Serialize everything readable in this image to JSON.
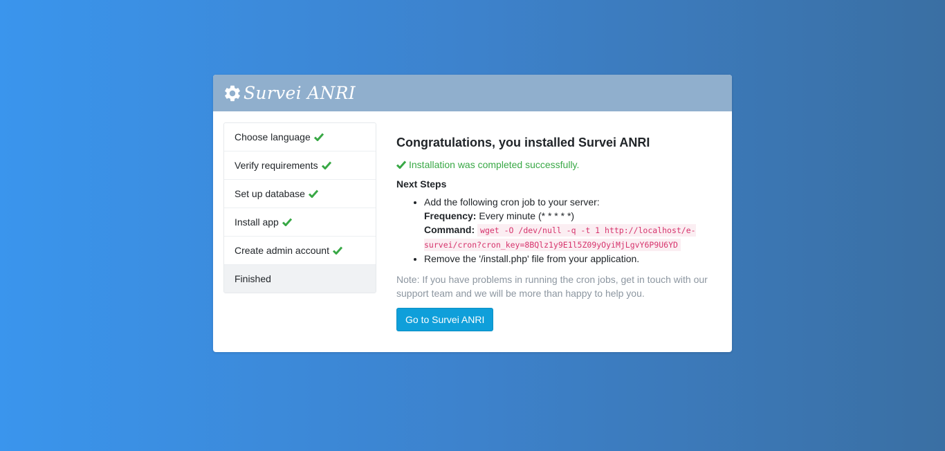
{
  "app": {
    "title": "Survei ANRI"
  },
  "steps": [
    {
      "label": "Choose language",
      "done": true
    },
    {
      "label": "Verify requirements",
      "done": true
    },
    {
      "label": "Set up database",
      "done": true
    },
    {
      "label": "Install app",
      "done": true
    },
    {
      "label": "Create admin account",
      "done": true
    },
    {
      "label": "Finished",
      "done": false,
      "active": true
    }
  ],
  "main": {
    "title": "Congratulations, you installed Survei ANRI",
    "success": "Installation was completed successfully.",
    "next_steps": "Next Steps",
    "cron_intro": "Add the following cron job to your server:",
    "frequency_label": "Frequency:",
    "frequency_value": "Every minute (* * * * *)",
    "command_label": "Command:",
    "command_value": "wget -O /dev/null -q -t 1 http://localhost/e-survei/cron?cron_key=8BQlz1y9E1l5Z09yOyiMjLgvY6P9U6YD",
    "remove_text": "Remove the '/install.php' file from your application.",
    "note": "Note: If you have problems in running the cron jobs, get in touch with our support team and we will be more than happy to help you.",
    "button": "Go to Survei ANRI"
  },
  "colors": {
    "success": "#38a845",
    "header_bg": "#90afcd",
    "button_bg": "#0f9fda",
    "code": "#d6336c"
  },
  "icons": {
    "logo": "gear-icon",
    "done": "check-icon"
  }
}
